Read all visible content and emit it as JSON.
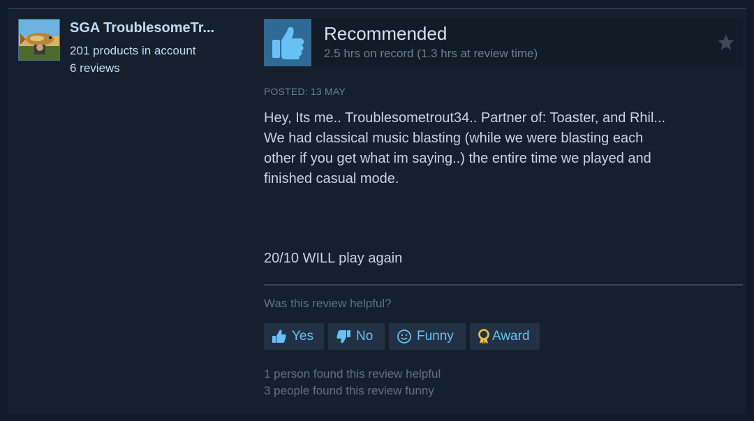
{
  "author": {
    "name": "SGA TroublesomeTr...",
    "products": "201 products in account",
    "reviews": "6 reviews"
  },
  "review": {
    "verdict": "Recommended",
    "hours": "2.5 hrs on record (1.3 hrs at review time)",
    "posted": "POSTED: 13 MAY",
    "lines": [
      "Hey, Its me.. Troublesometrout34.. Partner of: Toaster, and Rhil...",
      "We had classical music blasting (while we were blasting each",
      "other if you get what im saying..) the entire time we played and",
      "finished casual mode."
    ],
    "final_line": "20/10 WILL play again"
  },
  "helpful": {
    "question": "Was this review helpful?",
    "yes_label": "Yes",
    "no_label": "No",
    "funny_label": "Funny",
    "award_label": "Award",
    "found_helpful": "1 person found this review helpful",
    "found_funny": "3 people found this review funny"
  },
  "colors": {
    "accent": "#67c1f5",
    "thumb_box": "#2e6a93",
    "award_icon": "#f2c23a"
  },
  "icons": {
    "vote": "thumbs-up-icon",
    "star": "star-icon",
    "yes": "thumbs-up-icon",
    "no": "thumbs-down-icon",
    "funny": "smiley-icon",
    "award": "award-ribbon-icon"
  }
}
